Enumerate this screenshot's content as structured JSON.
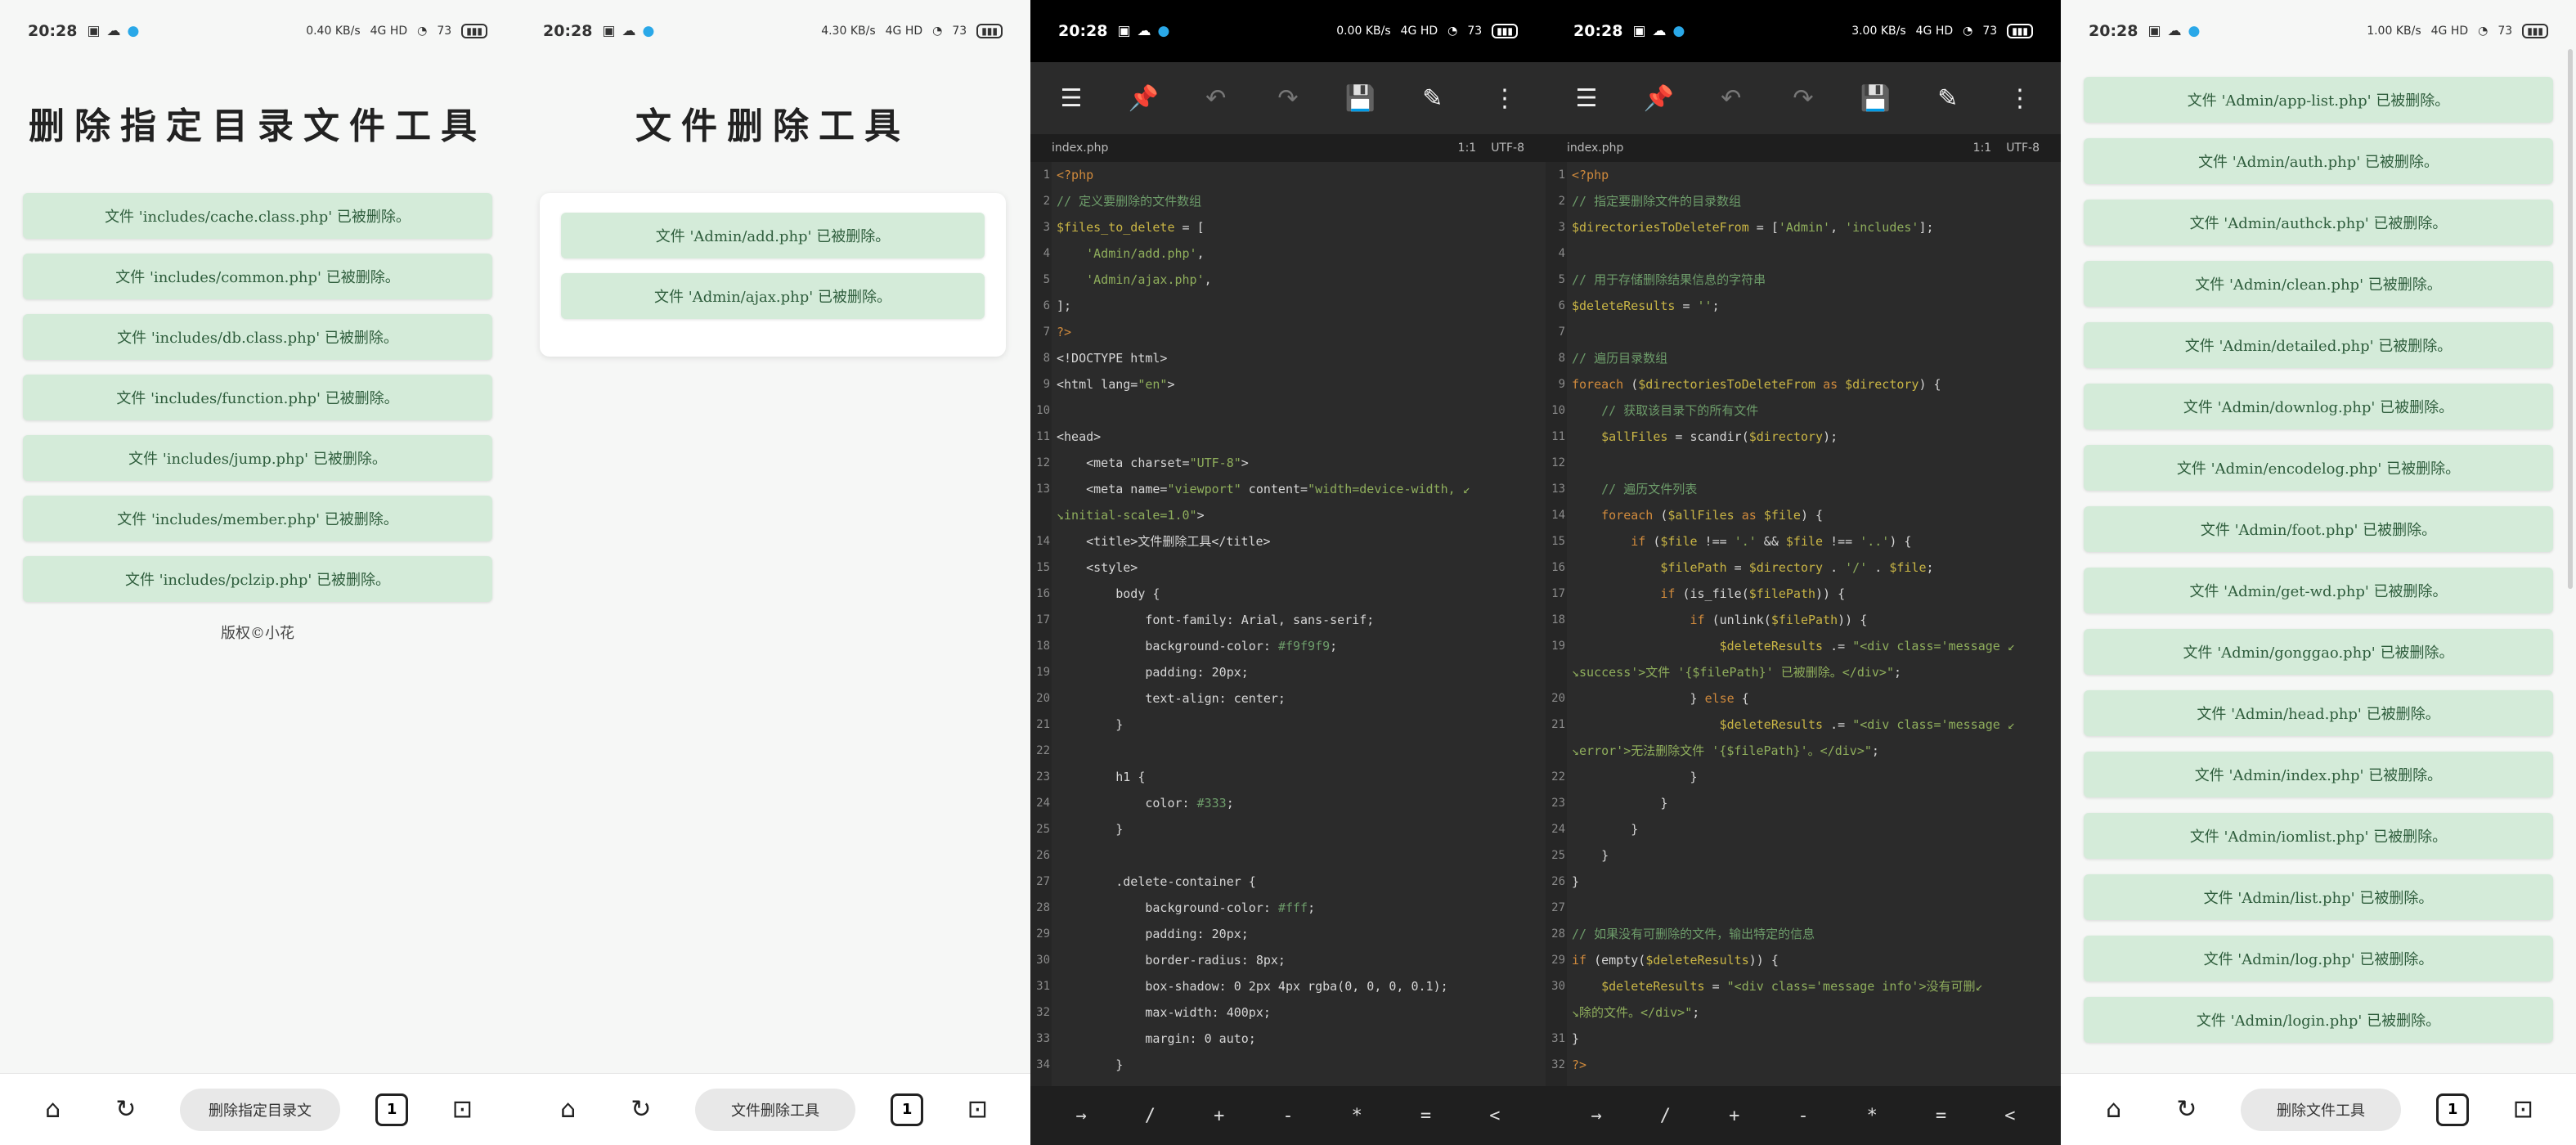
{
  "status": {
    "time": "20:28",
    "net_speed_1": "0.40 KB/s",
    "net_speed_2": "4.30 KB/s",
    "net_speed_3": "0.00 KB/s",
    "net_speed_4": "3.00 KB/s",
    "net_speed_5": "1.00 KB/s",
    "signal": "4G HD",
    "battery": "73"
  },
  "panel1": {
    "title": "删除指定目录文件工具",
    "messages": [
      "文件 'includes/cache.class.php' 已被删除。",
      "文件 'includes/common.php' 已被删除。",
      "文件 'includes/db.class.php' 已被删除。",
      "文件 'includes/function.php' 已被删除。",
      "文件 'includes/jump.php' 已被删除。",
      "文件 'includes/member.php' 已被删除。",
      "文件 'includes/pclzip.php' 已被删除。"
    ],
    "copyright": "版权©小花",
    "nav_pill": "删除指定目录文"
  },
  "panel2": {
    "title": "文件删除工具",
    "messages": [
      "文件 'Admin/add.php' 已被删除。",
      "文件 'Admin/ajax.php' 已被删除。"
    ],
    "nav_pill": "文件删除工具"
  },
  "editor": {
    "filename": "index.php",
    "cursor": "1:1",
    "encoding": "UTF-8",
    "keys": [
      "→",
      "/",
      "+",
      "-",
      "*",
      "=",
      "<"
    ]
  },
  "panel3_code": [
    {
      "n": "1",
      "h": "<span class=kw>&lt;?php</span>"
    },
    {
      "n": "2",
      "h": "<span class=cmt>// 定义要删除的文件数组</span>"
    },
    {
      "n": "3",
      "h": "<span class=var>$files_to_delete</span> = ["
    },
    {
      "n": "4",
      "h": "    <span class=str>'Admin/add.php'</span>,"
    },
    {
      "n": "5",
      "h": "    <span class=str>'Admin/ajax.php'</span>,"
    },
    {
      "n": "6",
      "h": "];"
    },
    {
      "n": "7",
      "h": "<span class=kw>?&gt;</span>"
    },
    {
      "n": "8",
      "h": "&lt;!DOCTYPE html&gt;"
    },
    {
      "n": "9",
      "h": "&lt;html lang=<span class=str>\"en\"</span>&gt;"
    },
    {
      "n": "10",
      "h": ""
    },
    {
      "n": "11",
      "h": "&lt;head&gt;"
    },
    {
      "n": "12",
      "h": "    &lt;meta charset=<span class=str>\"UTF-8\"</span>&gt;"
    },
    {
      "n": "13",
      "h": "    &lt;meta name=<span class=str>\"viewport\"</span> content=<span class=str>\"width=device-width, ↙</span>"
    },
    {
      "n": "",
      "h": "<span class=str>↘initial-scale=1.0\"</span>&gt;"
    },
    {
      "n": "14",
      "h": "    &lt;title&gt;文件删除工具&lt;/title&gt;"
    },
    {
      "n": "15",
      "h": "    &lt;style&gt;"
    },
    {
      "n": "16",
      "h": "        body {"
    },
    {
      "n": "17",
      "h": "            font-family: Arial, sans-serif;"
    },
    {
      "n": "18",
      "h": "            background-color: <span class=cmt>#f9f9f9</span>;"
    },
    {
      "n": "19",
      "h": "            padding: 20px;"
    },
    {
      "n": "20",
      "h": "            text-align: center;"
    },
    {
      "n": "21",
      "h": "        }"
    },
    {
      "n": "22",
      "h": ""
    },
    {
      "n": "23",
      "h": "        h1 {"
    },
    {
      "n": "24",
      "h": "            color: <span class=cmt>#333</span>;"
    },
    {
      "n": "25",
      "h": "        }"
    },
    {
      "n": "26",
      "h": ""
    },
    {
      "n": "27",
      "h": "        .delete-container {"
    },
    {
      "n": "28",
      "h": "            background-color: <span class=cmt>#fff</span>;"
    },
    {
      "n": "29",
      "h": "            padding: 20px;"
    },
    {
      "n": "30",
      "h": "            border-radius: 8px;"
    },
    {
      "n": "31",
      "h": "            box-shadow: 0 2px 4px rgba(0, 0, 0, 0.1);"
    },
    {
      "n": "32",
      "h": "            max-width: 400px;"
    },
    {
      "n": "33",
      "h": "            margin: 0 auto;"
    },
    {
      "n": "34",
      "h": "        }"
    }
  ],
  "panel4_code": [
    {
      "n": "1",
      "h": "<span class=kw>&lt;?php</span>"
    },
    {
      "n": "2",
      "h": "<span class=cmt>// 指定要删除文件的目录数组</span>"
    },
    {
      "n": "3",
      "h": "<span class=var>$directoriesToDeleteFrom</span> = [<span class=str>'Admin'</span>, <span class=str>'includes'</span>];"
    },
    {
      "n": "4",
      "h": ""
    },
    {
      "n": "5",
      "h": "<span class=cmt>// 用于存储删除结果信息的字符串</span>"
    },
    {
      "n": "6",
      "h": "<span class=var>$deleteResults</span> = <span class=str>''</span>;"
    },
    {
      "n": "7",
      "h": ""
    },
    {
      "n": "8",
      "h": "<span class=cmt>// 遍历目录数组</span>"
    },
    {
      "n": "9",
      "h": "<span class=kw>foreach</span> (<span class=var>$directoriesToDeleteFrom</span> <span class=kw>as</span> <span class=var>$directory</span>) {"
    },
    {
      "n": "10",
      "h": "    <span class=cmt>// 获取该目录下的所有文件</span>"
    },
    {
      "n": "11",
      "h": "    <span class=var>$allFiles</span> = scandir(<span class=var>$directory</span>);"
    },
    {
      "n": "12",
      "h": ""
    },
    {
      "n": "13",
      "h": "    <span class=cmt>// 遍历文件列表</span>"
    },
    {
      "n": "14",
      "h": "    <span class=kw>foreach</span> (<span class=var>$allFiles</span> <span class=kw>as</span> <span class=var>$file</span>) {"
    },
    {
      "n": "15",
      "h": "        <span class=kw>if</span> (<span class=var>$file</span> !== <span class=str>'.'</span> &amp;&amp; <span class=var>$file</span> !== <span class=str>'..'</span>) {"
    },
    {
      "n": "16",
      "h": "            <span class=var>$filePath</span> = <span class=var>$directory</span> . <span class=str>'/'</span> . <span class=var>$file</span>;"
    },
    {
      "n": "17",
      "h": "            <span class=kw>if</span> (is_file(<span class=var>$filePath</span>)) {"
    },
    {
      "n": "18",
      "h": "                <span class=kw>if</span> (unlink(<span class=var>$filePath</span>)) {"
    },
    {
      "n": "19",
      "h": "                    <span class=var>$deleteResults</span> .= <span class=str>\"&lt;div class='message ↙</span>"
    },
    {
      "n": "",
      "h": "<span class=str>↘success'&gt;文件 '{$filePath}' 已被删除。&lt;/div&gt;\"</span>;"
    },
    {
      "n": "20",
      "h": "                } <span class=kw>else</span> {"
    },
    {
      "n": "21",
      "h": "                    <span class=var>$deleteResults</span> .= <span class=str>\"&lt;div class='message ↙</span>"
    },
    {
      "n": "",
      "h": "<span class=str>↘error'&gt;无法删除文件 '{$filePath}'。&lt;/div&gt;\"</span>;"
    },
    {
      "n": "22",
      "h": "                }"
    },
    {
      "n": "23",
      "h": "            }"
    },
    {
      "n": "24",
      "h": "        }"
    },
    {
      "n": "25",
      "h": "    }"
    },
    {
      "n": "26",
      "h": "}"
    },
    {
      "n": "27",
      "h": ""
    },
    {
      "n": "28",
      "h": "<span class=cmt>// 如果没有可删除的文件，输出特定的信息</span>"
    },
    {
      "n": "29",
      "h": "<span class=kw>if</span> (empty(<span class=var>$deleteResults</span>)) {"
    },
    {
      "n": "30",
      "h": "    <span class=var>$deleteResults</span> = <span class=str>\"&lt;div class='message info'&gt;没有可删↙</span>"
    },
    {
      "n": "",
      "h": "<span class=str>↘除的文件。&lt;/div&gt;\"</span>;"
    },
    {
      "n": "31",
      "h": "}"
    },
    {
      "n": "32",
      "h": "<span class=kw>?&gt;</span>"
    }
  ],
  "panel5": {
    "messages": [
      "文件 'Admin/app-list.php' 已被删除。",
      "文件 'Admin/auth.php' 已被删除。",
      "文件 'Admin/authck.php' 已被删除。",
      "文件 'Admin/clean.php' 已被删除。",
      "文件 'Admin/detailed.php' 已被删除。",
      "文件 'Admin/downlog.php' 已被删除。",
      "文件 'Admin/encodelog.php' 已被删除。",
      "文件 'Admin/foot.php' 已被删除。",
      "文件 'Admin/get-wd.php' 已被删除。",
      "文件 'Admin/gonggao.php' 已被删除。",
      "文件 'Admin/head.php' 已被删除。",
      "文件 'Admin/index.php' 已被删除。",
      "文件 'Admin/iomlist.php' 已被删除。",
      "文件 'Admin/list.php' 已被删除。",
      "文件 'Admin/log.php' 已被删除。",
      "文件 'Admin/login.php' 已被删除。"
    ],
    "nav_pill": "删除文件工具"
  }
}
